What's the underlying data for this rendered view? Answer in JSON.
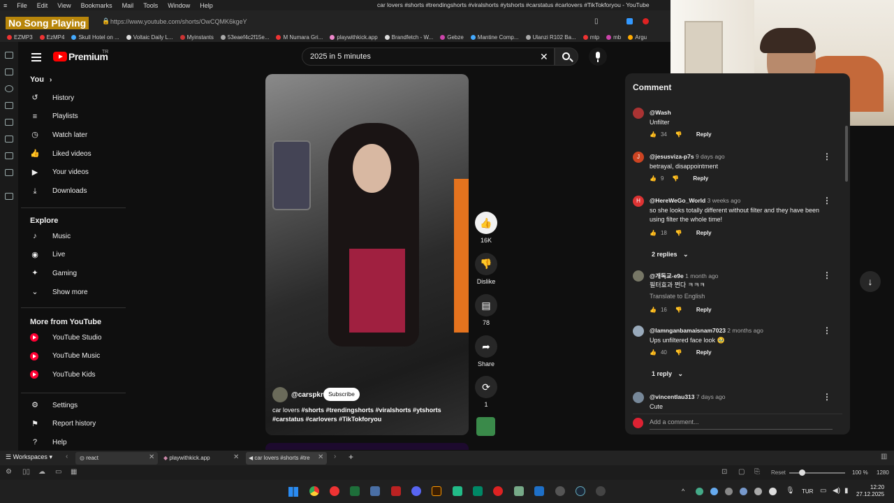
{
  "browser": {
    "menu": [
      "File",
      "Edit",
      "View",
      "Bookmarks",
      "Mail",
      "Tools",
      "Window",
      "Help"
    ],
    "window_title": "car lovers #shorts #trendingshorts #viralshorts #ytshorts #carstatus #carlovers #TikTokforyou - YouTube",
    "overlay_text": "No Song Playing",
    "url": "https://www.youtube.com/shorts/OwCQMK6kgeY",
    "bookmarks": [
      {
        "label": "EZMP3",
        "color": "#e33"
      },
      {
        "label": "EzMP4",
        "color": "#e33"
      },
      {
        "label": "Skull Hotel on ...",
        "color": "#4af"
      },
      {
        "label": "Voltaic Daily L...",
        "color": "#ddd"
      },
      {
        "label": "Myinstants",
        "color": "#c33"
      },
      {
        "label": "53eaef4c2f15e...",
        "color": "#aaa"
      },
      {
        "label": "M Numara Gri...",
        "color": "#e33"
      },
      {
        "label": "playwithkick.app",
        "color": "#e8c"
      },
      {
        "label": "Brandfetch - W...",
        "color": "#ddd"
      },
      {
        "label": "Gebze",
        "color": "#c4a"
      },
      {
        "label": "Mantine Comp...",
        "color": "#4af"
      },
      {
        "label": "Ulanzi R102 Ba...",
        "color": "#aaa"
      },
      {
        "label": "mtp",
        "color": "#e33"
      },
      {
        "label": "mb",
        "color": "#c4a"
      },
      {
        "label": "Argu",
        "color": "#fa0"
      }
    ]
  },
  "youtube": {
    "logo_text": "Premium",
    "region": "TR",
    "search_value": "2025 in 5 minutes",
    "sidebar": {
      "you_label": "You",
      "you_items": [
        {
          "label": "History",
          "icon": "history-icon",
          "glyph": "↺"
        },
        {
          "label": "Playlists",
          "icon": "playlists-icon",
          "glyph": "≡"
        },
        {
          "label": "Watch later",
          "icon": "clock-icon",
          "glyph": "◷"
        },
        {
          "label": "Liked videos",
          "icon": "thumb-up-icon",
          "glyph": "👍"
        },
        {
          "label": "Your videos",
          "icon": "video-icon",
          "glyph": "▶"
        },
        {
          "label": "Downloads",
          "icon": "download-icon",
          "glyph": "⤓"
        }
      ],
      "explore_label": "Explore",
      "explore_items": [
        {
          "label": "Music",
          "icon": "music-icon",
          "glyph": "♪"
        },
        {
          "label": "Live",
          "icon": "live-icon",
          "glyph": "◉"
        },
        {
          "label": "Gaming",
          "icon": "gaming-icon",
          "glyph": "✦"
        },
        {
          "label": "Show more",
          "icon": "chevron-down-icon",
          "glyph": "⌄"
        }
      ],
      "more_label": "More from YouTube",
      "more_items": [
        "YouTube Studio",
        "YouTube Music",
        "YouTube Kids"
      ],
      "settings_items": [
        {
          "label": "Settings",
          "icon": "gear-icon",
          "glyph": "⚙"
        },
        {
          "label": "Report history",
          "icon": "flag-icon",
          "glyph": "⚑"
        },
        {
          "label": "Help",
          "icon": "help-icon",
          "glyph": "?"
        }
      ]
    },
    "short": {
      "channel": "@carspkr",
      "subscribe": "Subscribe",
      "caption_line1_tags": "#shorts #trendingshorts #viralshorts #ytshorts",
      "caption_line1_prefix": "car lovers ",
      "caption_line2": "#carstatus #carlovers #TikTokforyou",
      "likes": "16K",
      "dislike": "Dislike",
      "comments": "78",
      "share": "Share",
      "remix": "1"
    },
    "comments": {
      "header": "Comment",
      "add_placeholder": "Add a comment...",
      "items": [
        {
          "user": "@Wash",
          "time": "",
          "text": "Unfilter",
          "likes": "34",
          "reply": "Reply",
          "avatar": "#a33",
          "initial": ""
        },
        {
          "user": "@jesusviza-p7s",
          "time": "9 days ago",
          "text": "betrayal, disappointment",
          "likes": "9",
          "reply": "Reply",
          "avatar": "#c42",
          "initial": "J"
        },
        {
          "user": "@HereWeGo_World",
          "time": "3 weeks ago",
          "text": "so she looks totally different without filter and they have been using filter the whole time!",
          "likes": "18",
          "reply": "Reply",
          "avatar": "#d33",
          "initial": "H",
          "replies": "2 replies"
        },
        {
          "user": "@개독교-e9e",
          "time": "1 month ago",
          "text": "필터효과 쩐다 ㅋㅋㅋ",
          "translate": "Translate to English",
          "likes": "16",
          "reply": "Reply",
          "avatar": "#776",
          "initial": ""
        },
        {
          "user": "@lamnganbamaisnam7023",
          "time": "2 months ago",
          "text": "Ups unfiltered face look 🥹",
          "likes": "40",
          "reply": "Reply",
          "avatar": "#9ab",
          "initial": "",
          "replies": "1 reply"
        },
        {
          "user": "@vincentlau313",
          "time": "7 days ago",
          "text": "Cute",
          "avatar": "#789",
          "initial": ""
        }
      ]
    }
  },
  "tabs": {
    "workspaces": "Workspaces",
    "items": [
      "react",
      "playwithkick.app",
      "car lovers #shorts #tre"
    ]
  },
  "status": {
    "reset": "Reset",
    "zoom": "100 %",
    "width": "1280"
  },
  "taskbar": {
    "lang": "TUR",
    "time": "12:20",
    "date": "27.12.2025"
  }
}
